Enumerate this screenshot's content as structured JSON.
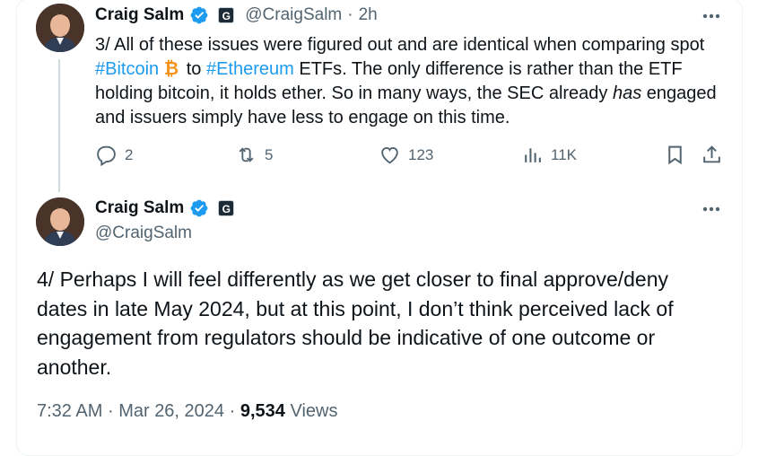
{
  "tweet1": {
    "name": "Craig Salm",
    "handle": "@CraigSalm",
    "time": "2h",
    "separator": "·",
    "affiliate": "G",
    "text_part1": "3/ All of these issues were figured out and are identical when comparing spot ",
    "hashtag_bitcoin": "#Bitcoin",
    "text_to": " to ",
    "hashtag_ethereum": "#Ethereum",
    "text_part2": " ETFs. The only difference is rather than the ETF holding bitcoin, it holds ether. So in many ways, the SEC already ",
    "text_emphasis": "has",
    "text_part3": " engaged and issuers simply have less to engage on this time.",
    "replies": "2",
    "reposts": "5",
    "likes": "123",
    "views": "11K",
    "bitcoin_icon": "bitcoin-icon",
    "bitcoin_color": "#f7931a"
  },
  "tweet2": {
    "name": "Craig Salm",
    "handle": "@CraigSalm",
    "affiliate": "G",
    "text": "4/ Perhaps I will feel differently as we get closer to final approve/deny dates in late May 2024, but at this point, I don’t think perceived lack of engagement from regulators should be indicative of one outcome or another.",
    "time": "7:32 AM",
    "separator": "·",
    "date": "Mar 26, 2024",
    "views_count": "9,534",
    "views_label": "Views"
  },
  "colors": {
    "link": "#1d9bf0",
    "verified": "#1d9bf0",
    "secondary_text": "#536471",
    "primary_text": "#0f1419"
  }
}
